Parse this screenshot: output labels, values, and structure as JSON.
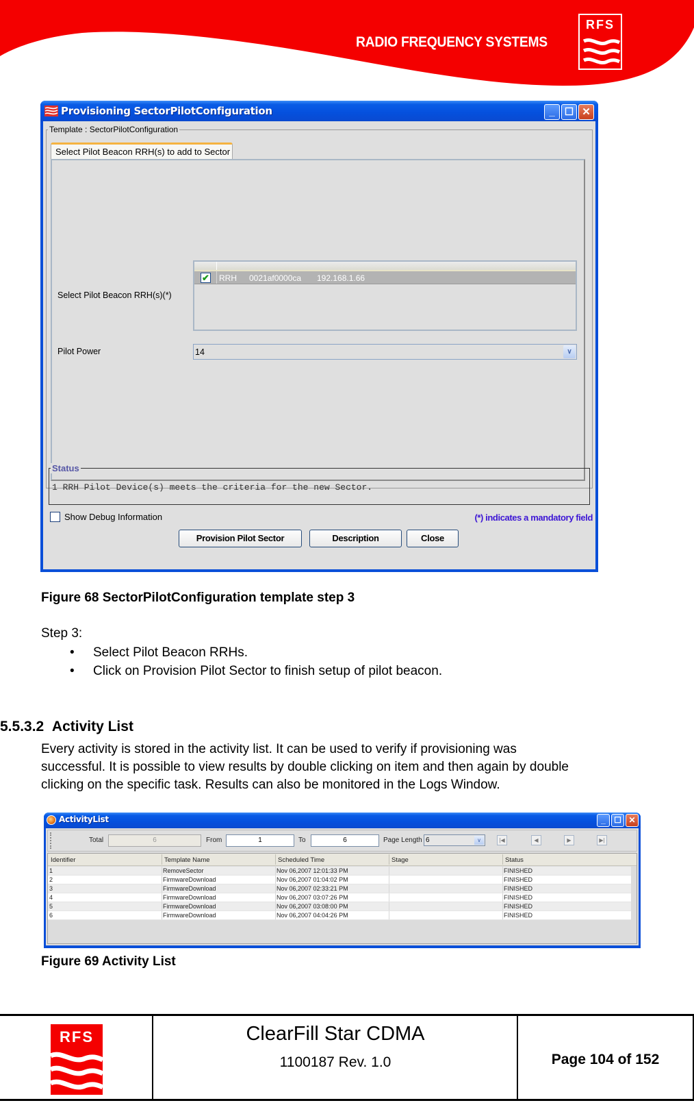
{
  "header": {
    "brand_name": "RADIO FREQUENCY SYSTEMS",
    "logo_text": "RFS",
    "brand_color": "#f40000"
  },
  "provisioning_window": {
    "title": "Provisioning SectorPilotConfiguration",
    "icon": "rfs-waves-icon",
    "template_group_label": "Template : SectorPilotConfiguration",
    "tab_label": "Select Pilot Beacon RRH(s) to add to Sector",
    "select_rrh_label": "Select Pilot Beacon RRH(s)(*)",
    "rrh_rows": [
      {
        "checked": true,
        "type": "RRH",
        "id": "0021af0000ca",
        "ip": "192.168.1.66"
      }
    ],
    "rrh_checkmark": "✔",
    "pilot_power_label": "Pilot Power",
    "pilot_power_value": "14",
    "status_group_label": "Status",
    "status_text": "1 RRH Pilot Device(s) meets the criteria for the new Sector.",
    "show_debug_label": "Show Debug Information",
    "show_debug_checked": false,
    "mandatory_note": "(*) indicates a mandatory field",
    "buttons": {
      "provision": "Provision Pilot Sector",
      "description": "Description",
      "close": "Close"
    },
    "window_controls": {
      "minimize": "_",
      "maximize": "☐",
      "close": "✕"
    }
  },
  "figure68_caption": "Figure 68 SectorPilotConfiguration template step 3",
  "step": {
    "title": "Step 3:",
    "bullets": [
      "Select Pilot Beacon RRHs.",
      "Click on Provision Pilot Sector to finish setup of pilot beacon."
    ],
    "bullet_glyph": "•"
  },
  "section": {
    "number": "5.5.3.2",
    "title": "Activity List",
    "paragraph_lines": [
      "Every activity is stored in the activity list. It can be used to verify if provisioning was",
      "successful. It is possible to view results by double clicking on item and then again by double",
      "clicking on the specific task. Results can also be monitored in the Logs Window."
    ]
  },
  "activity_window": {
    "title": "ActivityList",
    "toolbar": {
      "total_label": "Total",
      "total_value": "6",
      "from_label": "From",
      "from_value": "1",
      "to_label": "To",
      "to_value": "6",
      "page_length_label": "Page Length",
      "page_length_value": "6",
      "nav": {
        "first": "|◀",
        "prev": "◀",
        "next": "▶",
        "last": "▶|"
      }
    },
    "columns": [
      "Identifier",
      "Template Name",
      "Scheduled Time",
      "Stage",
      "Status"
    ],
    "rows": [
      [
        "1",
        "RemoveSector",
        "Nov 06,2007 12:01:33 PM",
        "",
        "FINISHED"
      ],
      [
        "2",
        "FirmwareDownload",
        "Nov 06,2007 01:04:02 PM",
        "",
        "FINISHED"
      ],
      [
        "3",
        "FirmwareDownload",
        "Nov 06,2007 02:33:21 PM",
        "",
        "FINISHED"
      ],
      [
        "4",
        "FirmwareDownload",
        "Nov 06,2007 03:07:26 PM",
        "",
        "FINISHED"
      ],
      [
        "5",
        "FirmwareDownload",
        "Nov 06,2007 03:08:00 PM",
        "",
        "FINISHED"
      ],
      [
        "6",
        "FirmwareDownload",
        "Nov 06,2007 04:04:26 PM",
        "",
        "FINISHED"
      ]
    ],
    "window_controls": {
      "minimize": "_",
      "maximize": "☐",
      "close": "✕"
    }
  },
  "figure69_caption": "Figure 69 Activity List",
  "footer": {
    "logo_text": "RFS",
    "product": "ClearFill Star CDMA",
    "revision": "1100187 Rev. 1.0",
    "page": "Page 104 of 152"
  }
}
